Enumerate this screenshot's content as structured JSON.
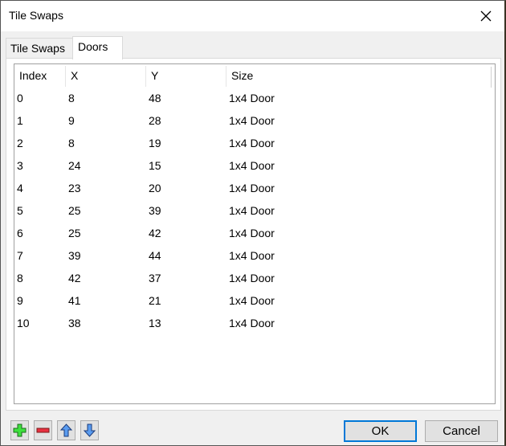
{
  "window": {
    "title": "Tile Swaps",
    "close_icon": "close-x-icon"
  },
  "tabs": [
    {
      "label": "Tile Swaps",
      "selected": false
    },
    {
      "label": "Doors",
      "selected": true
    }
  ],
  "doors_table": {
    "columns": [
      "Index",
      "X",
      "Y",
      "Size"
    ],
    "rows": [
      {
        "index": "0",
        "x": "8",
        "y": "48",
        "size": "1x4 Door"
      },
      {
        "index": "1",
        "x": "9",
        "y": "28",
        "size": "1x4 Door"
      },
      {
        "index": "2",
        "x": "8",
        "y": "19",
        "size": "1x4 Door"
      },
      {
        "index": "3",
        "x": "24",
        "y": "15",
        "size": "1x4 Door"
      },
      {
        "index": "4",
        "x": "23",
        "y": "20",
        "size": "1x4 Door"
      },
      {
        "index": "5",
        "x": "25",
        "y": "39",
        "size": "1x4 Door"
      },
      {
        "index": "6",
        "x": "25",
        "y": "42",
        "size": "1x4 Door"
      },
      {
        "index": "7",
        "x": "39",
        "y": "44",
        "size": "1x4 Door"
      },
      {
        "index": "8",
        "x": "42",
        "y": "37",
        "size": "1x4 Door"
      },
      {
        "index": "9",
        "x": "41",
        "y": "21",
        "size": "1x4 Door"
      },
      {
        "index": "10",
        "x": "38",
        "y": "13",
        "size": "1x4 Door"
      }
    ]
  },
  "toolbar": {
    "add_icon": "plus-icon",
    "remove_icon": "minus-icon",
    "move_up_icon": "arrow-up-icon",
    "move_down_icon": "arrow-down-icon"
  },
  "buttons": {
    "ok_label": "OK",
    "cancel_label": "Cancel"
  },
  "colors": {
    "accent_focus": "#0078d7",
    "add_green": "#3ee03e",
    "remove_red": "#e83040",
    "arrow_blue": "#5a9cf0"
  }
}
